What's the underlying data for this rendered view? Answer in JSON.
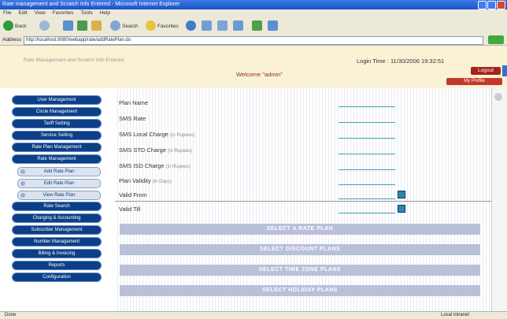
{
  "window": {
    "title": "Rate management and Scratch Info Entered - Microsoft Internet Explorer"
  },
  "menu": [
    "File",
    "Edit",
    "View",
    "Favorites",
    "Tools",
    "Help"
  ],
  "toolbar": {
    "back_label": "Back",
    "search_label": "Search",
    "favorites_label": "Favorites"
  },
  "address": {
    "label": "Address",
    "url": "http://localhost:8080/webapp/rate/addRatePlan.do",
    "go_label": "Go"
  },
  "header": {
    "subtitle": "Rate Management and Scratch Info Entered",
    "login_time": "Login Time : 11/30/2006 19:32:51",
    "welcome": "Welcome \"admin\"",
    "logout": "Logout",
    "profile": "My Profile"
  },
  "sidebar": {
    "items": [
      "User Management",
      "Circle Management",
      "Tariff Setting",
      "Service Setting",
      "Rate Plan Management",
      "Rate Management"
    ],
    "subitems": [
      "Add Rate Plan",
      "Edit Rate Plan",
      "View Rate Plan"
    ],
    "items_bottom": [
      "Rate Search",
      "Charging & Accounting",
      "Subscriber Management",
      "Number Management",
      "Billing & Invoicing",
      "Reports",
      "Configuration"
    ]
  },
  "form": {
    "fields": [
      {
        "label": "Plan Name",
        "note": ""
      },
      {
        "label": "SMS Rate",
        "note": ""
      },
      {
        "label": "SMS Local Charge",
        "note": "(in Rupees)"
      },
      {
        "label": "SMS STD Charge",
        "note": "(in Rupees)"
      },
      {
        "label": "SMS ISD Charge",
        "note": "(in Rupees)"
      },
      {
        "label": "Plan Validity",
        "note": "(in Days)"
      },
      {
        "label": "Valid From",
        "note": ""
      },
      {
        "label": "Valid Till",
        "note": ""
      }
    ],
    "plan_buttons": [
      "SELECT A RATE PLAN",
      "SELECT DISCOUNT PLANS",
      "SELECT TIME ZONE PLANS",
      "SELECT HOLIDAY PLANS"
    ]
  },
  "status": {
    "left": "Done",
    "right": "Local intranet"
  },
  "colors": {
    "nav_button": "#0c3f86",
    "header_bg": "#fbf2d6",
    "plan_bar": "#b9c0d8",
    "logout_bg": "#a32418"
  }
}
